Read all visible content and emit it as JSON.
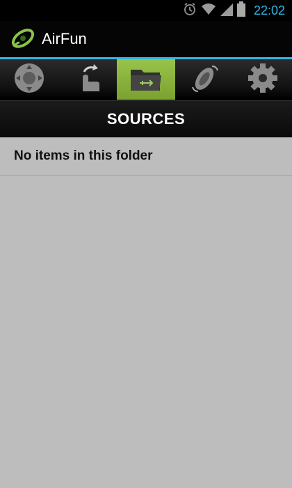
{
  "status_bar": {
    "time": "22:02",
    "icons": [
      "alarm-icon",
      "wifi-icon",
      "signal-icon",
      "battery-icon"
    ],
    "accent_color": "#33b5e5"
  },
  "action_bar": {
    "app_title": "AirFun",
    "logo_icon": "airfun-logo-icon"
  },
  "tabs": [
    {
      "icon": "remote-dpad-icon",
      "active": false
    },
    {
      "icon": "touch-gesture-icon",
      "active": false
    },
    {
      "icon": "folder-usb-icon",
      "active": true
    },
    {
      "icon": "air-mouse-icon",
      "active": false
    },
    {
      "icon": "settings-gear-icon",
      "active": false
    }
  ],
  "section": {
    "title": "SOURCES"
  },
  "list": {
    "empty_message": "No items in this folder"
  },
  "colors": {
    "active_tab": "#8bb53c",
    "background": "#bdbdbd"
  }
}
